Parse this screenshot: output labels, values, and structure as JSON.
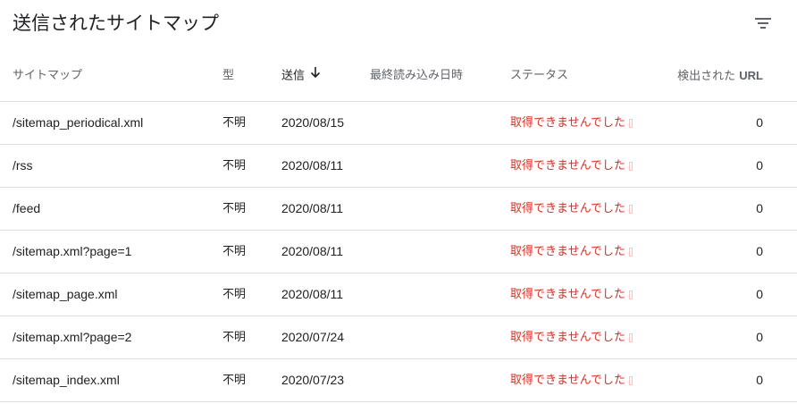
{
  "header": {
    "title": "送信されたサイトマップ",
    "filter_icon": "filter-list-icon"
  },
  "columns": {
    "sitemap": "サイトマップ",
    "type": "型",
    "submitted": "送信",
    "last_read": "最終読み込み日時",
    "status": "ステータス",
    "urls_prefix": "検出された",
    "urls_suffix": "URL"
  },
  "sort": {
    "column": "submitted",
    "direction": "descending",
    "icon": "arrow-down-icon"
  },
  "colors": {
    "status_error": "#d93025",
    "text": "#202124",
    "muted": "#5f6368"
  },
  "rows": [
    {
      "path": "/sitemap_periodical.xml",
      "type": "不明",
      "submitted": "2020/08/15",
      "last_read": "",
      "status": "取得できませんでした",
      "urls": "0"
    },
    {
      "path": "/rss",
      "type": "不明",
      "submitted": "2020/08/11",
      "last_read": "",
      "status": "取得できませんでした",
      "urls": "0"
    },
    {
      "path": "/feed",
      "type": "不明",
      "submitted": "2020/08/11",
      "last_read": "",
      "status": "取得できませんでした",
      "urls": "0"
    },
    {
      "path": "/sitemap.xml?page=1",
      "type": "不明",
      "submitted": "2020/08/11",
      "last_read": "",
      "status": "取得できませんでした",
      "urls": "0"
    },
    {
      "path": "/sitemap_page.xml",
      "type": "不明",
      "submitted": "2020/08/11",
      "last_read": "",
      "status": "取得できませんでした",
      "urls": "0"
    },
    {
      "path": "/sitemap.xml?page=2",
      "type": "不明",
      "submitted": "2020/07/24",
      "last_read": "",
      "status": "取得できませんでした",
      "urls": "0"
    },
    {
      "path": "/sitemap_index.xml",
      "type": "不明",
      "submitted": "2020/07/23",
      "last_read": "",
      "status": "取得できませんでした",
      "urls": "0"
    }
  ]
}
